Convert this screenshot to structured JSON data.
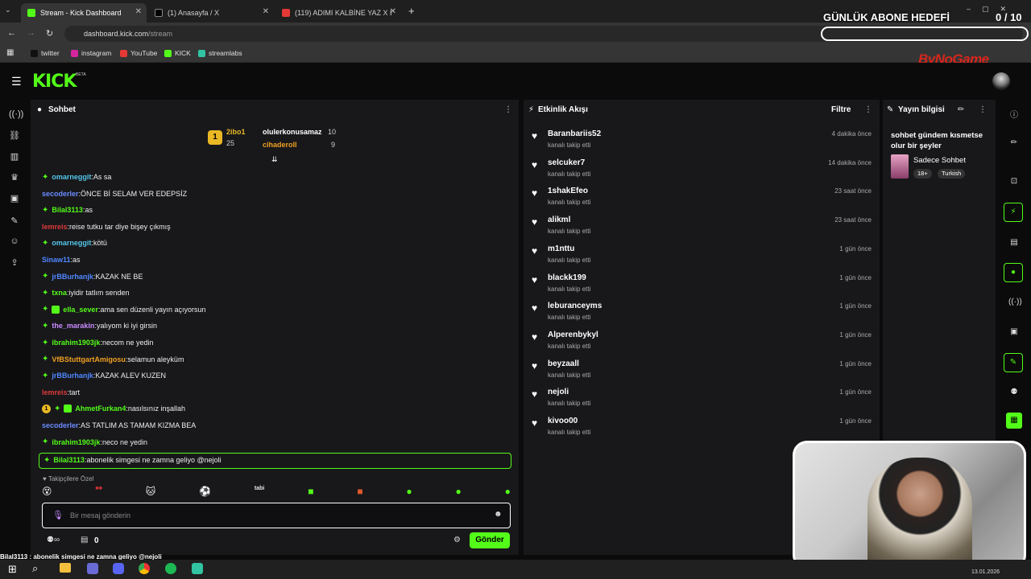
{
  "browser": {
    "tabs": [
      {
        "title": "Stream - Kick Dashboard",
        "active": true
      },
      {
        "title": "(1) Anasayfa / X",
        "active": false
      },
      {
        "title": "(119) ADIMI KALBİNE YAZ X BY...",
        "active": false
      }
    ],
    "url_domain": "dashboard.kick.com",
    "url_path": "/stream",
    "bookmarks": [
      "twitter",
      "instagram",
      "YouTube",
      "KICK",
      "streamlabs"
    ]
  },
  "overlay": {
    "goal_title": "GÜNLÜK ABONE HEDEFİ",
    "goal_count": "0 / 10",
    "goal_progress": 0.0,
    "brand": "ByNoGame",
    "ticker": "Bilal3113 : abonelik simgesi ne zamna geliyo @nejoli",
    "date": "13.01.2026"
  },
  "kick": {
    "logo": "KICK",
    "logo_badge": "BETA",
    "accent": "#53fc18"
  },
  "chat": {
    "title": "Sohbet",
    "leaderboard": [
      {
        "name": "2ibo1",
        "value": "25"
      },
      {
        "name": "olulerkonusamaz",
        "value": "10"
      },
      {
        "name": "cihaderoll",
        "value": "9"
      }
    ],
    "messages": [
      {
        "user": "omarneggit",
        "text": "As sa",
        "color": "#53c6e8",
        "badge": "dia"
      },
      {
        "user": "secoderler",
        "text": "ÖNCE Bİ SELAM VER EDEPSİZ",
        "color": "#6b8cff",
        "badge": ""
      },
      {
        "user": "Bilal3113",
        "text": "as",
        "color": "#53fc18",
        "badge": "dia"
      },
      {
        "user": "lemreis",
        "text": "reise tutku tar diye bişey çıkmış",
        "color": "#e03a3a",
        "badge": ""
      },
      {
        "user": "omarneggit",
        "text": "kötü",
        "color": "#53c6e8",
        "badge": "dia"
      },
      {
        "user": "Sinaw11",
        "text": "as",
        "color": "#4f87ff",
        "badge": ""
      },
      {
        "user": "jrBBurhanjk",
        "text": "KAZAK NE BE",
        "color": "#4f87ff",
        "badge": "dia"
      },
      {
        "user": "txna",
        "text": "iyidir tatlım senden",
        "color": "#53fc18",
        "badge": "dia"
      },
      {
        "user": "ella_sever",
        "text": "ama sen düzenli yayın açıyorsun",
        "color": "#53fc18",
        "badge": "dia-sub"
      },
      {
        "user": "the_marakin",
        "text": "yalıyom ki iyi girsin",
        "color": "#c98cff",
        "badge": "dia"
      },
      {
        "user": "ibrahim1903jk",
        "text": "necom ne yedin",
        "color": "#53fc18",
        "badge": "dia"
      },
      {
        "user": "VfBStuttgartAmigosu",
        "text": "selamun aleyküm",
        "color": "#f0a020",
        "badge": "dia"
      },
      {
        "user": "jrBBurhanjk",
        "text": "KAZAK ALEV KUZEN",
        "color": "#4f87ff",
        "badge": "dia"
      },
      {
        "user": "lemreis",
        "text": "tart",
        "color": "#e03a3a",
        "badge": ""
      },
      {
        "user": "AhmetFurkan4",
        "text": "nasılsınız inşallah",
        "color": "#53fc18",
        "badge": "coin-dia-sub"
      },
      {
        "user": "secoderler",
        "text": "AS TATLIM AS TAMAM KIZMA BEA",
        "color": "#6b8cff",
        "badge": ""
      },
      {
        "user": "ibrahim1903jk",
        "text": "neco ne yedin",
        "color": "#53fc18",
        "badge": "dia"
      },
      {
        "user": "Bilal3113",
        "text": "abonelik simgesi ne zamna geliyo @nejoli",
        "color": "#53fc18",
        "badge": "dia"
      }
    ],
    "followers_only": "Takipçilere Özel",
    "input_placeholder": "Bir mesaj gönderin",
    "points": "0",
    "send_label": "Gönder"
  },
  "activity": {
    "title": "Etkinlik Akışı",
    "filter_label": "Filtre",
    "items": [
      {
        "name": "Baranbariis52",
        "sub": "kanalı takip etti",
        "time": "4 dakika önce"
      },
      {
        "name": "selcuker7",
        "sub": "kanalı takip etti",
        "time": "14 dakika önce"
      },
      {
        "name": "1shakEfeo",
        "sub": "kanalı takip etti",
        "time": "23 saat önce"
      },
      {
        "name": "alikml",
        "sub": "kanalı takip etti",
        "time": "23 saat önce"
      },
      {
        "name": "m1nttu",
        "sub": "kanalı takip etti",
        "time": "1 gün önce"
      },
      {
        "name": "blackk199",
        "sub": "kanalı takip etti",
        "time": "1 gün önce"
      },
      {
        "name": "leburanceyms",
        "sub": "kanalı takip etti",
        "time": "1 gün önce"
      },
      {
        "name": "Alperenbykyl",
        "sub": "kanalı takip etti",
        "time": "1 gün önce"
      },
      {
        "name": "beyzaall",
        "sub": "kanalı takip etti",
        "time": "1 gün önce"
      },
      {
        "name": "nejoli",
        "sub": "kanalı takip etti",
        "time": "1 gün önce"
      },
      {
        "name": "kivoo00",
        "sub": "kanalı takip etti",
        "time": "1 gün önce"
      }
    ]
  },
  "streaminfo": {
    "title": "Yayın bilgisi",
    "stream_title": "sohbet gündem kısmetse olur bir şeyler",
    "category": "Sadece Sohbet",
    "tags": [
      "18+",
      "Turkish"
    ]
  }
}
